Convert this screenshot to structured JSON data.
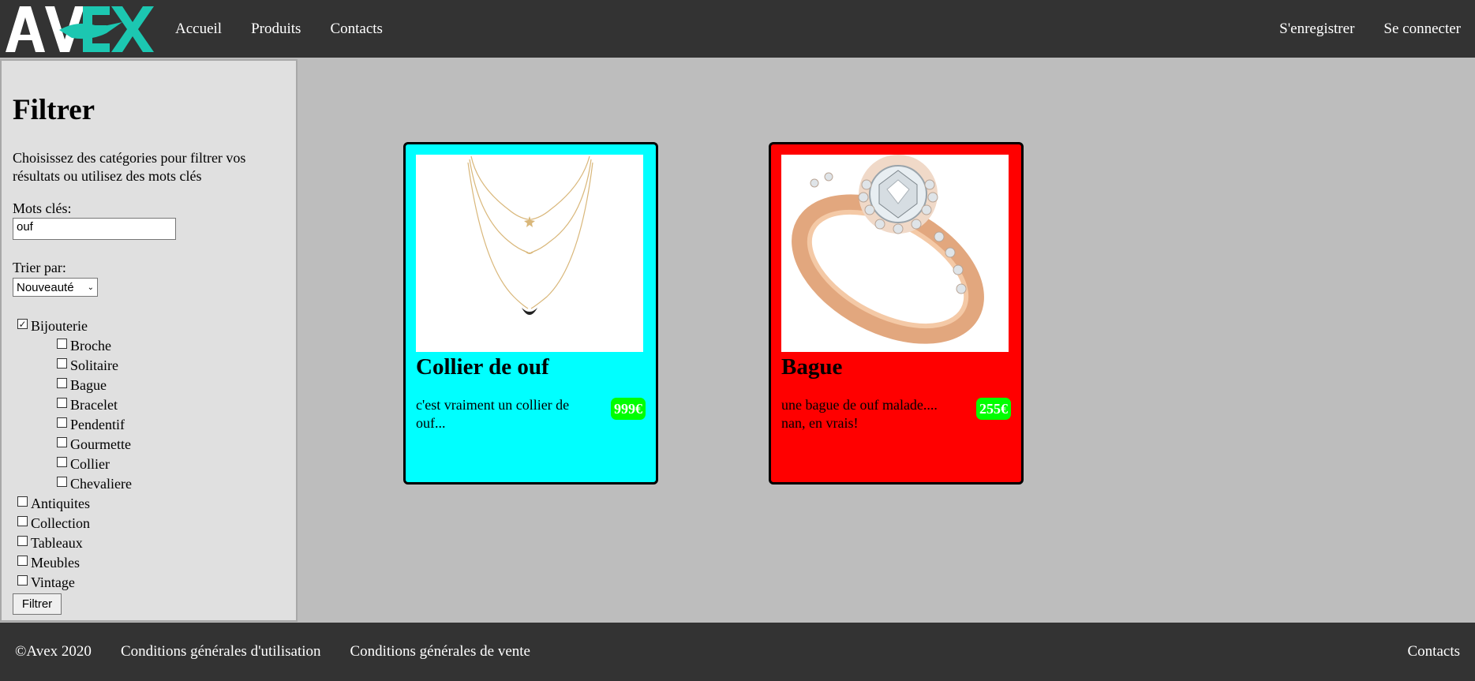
{
  "brand": {
    "logo_text": "AVEX"
  },
  "nav": {
    "left": [
      "Accueil",
      "Produits",
      "Contacts"
    ],
    "right": [
      "S'enregistrer",
      "Se connecter"
    ]
  },
  "sidebar": {
    "title": "Filtrer",
    "description": "Choisissez des catégories pour filtrer vos résultats ou utilisez des mots clés",
    "keywords_label": "Mots clés:",
    "keywords_value": "ouf",
    "sort_label": "Trier par:",
    "sort_value": "Nouveauté",
    "categories": [
      {
        "label": "Bijouterie",
        "checked": true,
        "level": 0
      },
      {
        "label": "Broche",
        "checked": false,
        "level": 1
      },
      {
        "label": "Solitaire",
        "checked": false,
        "level": 1
      },
      {
        "label": "Bague",
        "checked": false,
        "level": 1
      },
      {
        "label": "Bracelet",
        "checked": false,
        "level": 1
      },
      {
        "label": "Pendentif",
        "checked": false,
        "level": 1
      },
      {
        "label": "Gourmette",
        "checked": false,
        "level": 1
      },
      {
        "label": "Collier",
        "checked": false,
        "level": 1
      },
      {
        "label": "Chevaliere",
        "checked": false,
        "level": 1
      },
      {
        "label": "Antiquites",
        "checked": false,
        "level": 0
      },
      {
        "label": "Collection",
        "checked": false,
        "level": 0
      },
      {
        "label": "Tableaux",
        "checked": false,
        "level": 0
      },
      {
        "label": "Meubles",
        "checked": false,
        "level": 0
      },
      {
        "label": "Vintage",
        "checked": false,
        "level": 0
      }
    ],
    "filter_button": "Filtrer"
  },
  "products": [
    {
      "title": "Collier de ouf",
      "description": "c'est vraiment un collier de ouf...",
      "price": "999€",
      "bg_color": "#00ffff",
      "image": "necklace"
    },
    {
      "title": "Bague",
      "description": "une bague de ouf malade.... nan, en vrais!",
      "price": "255€",
      "bg_color": "#ff0000",
      "image": "ring"
    }
  ],
  "footer": {
    "copyright": "©Avex 2020",
    "links": [
      "Conditions générales d'utilisation",
      "Conditions générales de vente"
    ],
    "right": "Contacts"
  }
}
